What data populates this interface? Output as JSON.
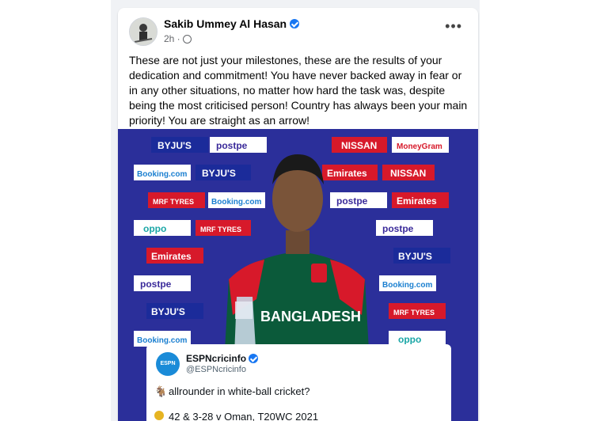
{
  "post": {
    "author": "Sakib Ummey Al Hasan",
    "time": "2h · ",
    "more_label": "•••",
    "text": "These are not just your milestones, these are the results of your dedication and commitment! You have never backed away in fear or in any other situations, no matter how hard the task was, despite being the most criticised person! Country has always been your main priority! You are straight as an arrow!"
  },
  "photo": {
    "sponsors": [
      "BYJU'S",
      "postpe",
      "NISSAN",
      "MoneyGram",
      "Booking.com",
      "Emirates",
      "MRF TYRES",
      "oppo"
    ],
    "jersey_text": "BANGLADESH",
    "jersey_color": "#0b5a3a",
    "backdrop_color": "#2b2f9a"
  },
  "tweet": {
    "name": "ESPNcricinfo",
    "handle": "@ESPNcricinfo",
    "logo_text": "ESPN cricinfo",
    "line1": "allrounder in white-ball cricket?",
    "line2": "42 & 3-28 v Oman, T20WC 2021"
  }
}
